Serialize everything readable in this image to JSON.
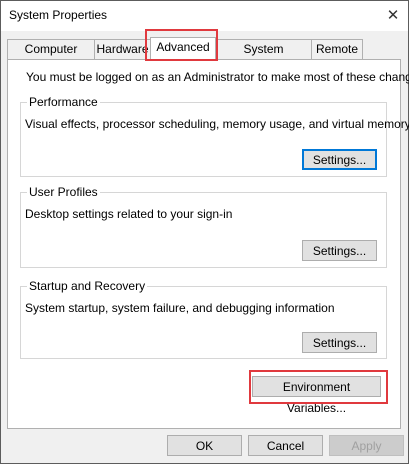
{
  "window": {
    "title": "System Properties",
    "close_glyph": "✕"
  },
  "tabs": [
    {
      "label": "Computer Name"
    },
    {
      "label": "Hardware"
    },
    {
      "label": "Advanced",
      "selected": true
    },
    {
      "label": "System Protection"
    },
    {
      "label": "Remote"
    }
  ],
  "advanced": {
    "admin_note": "You must be logged on as an Administrator to make most of these changes.",
    "performance": {
      "title": "Performance",
      "description": "Visual effects, processor scheduling, memory usage, and virtual memory",
      "button": "Settings..."
    },
    "user_profiles": {
      "title": "User Profiles",
      "description": "Desktop settings related to your sign-in",
      "button": "Settings..."
    },
    "startup_recovery": {
      "title": "Startup and Recovery",
      "description": "System startup, system failure, and debugging information",
      "button": "Settings..."
    },
    "env_button": "Environment Variables..."
  },
  "footer": {
    "ok": "OK",
    "cancel": "Cancel",
    "apply": "Apply"
  },
  "colors": {
    "highlight": "#e0393e",
    "focus_border": "#0078d7"
  }
}
